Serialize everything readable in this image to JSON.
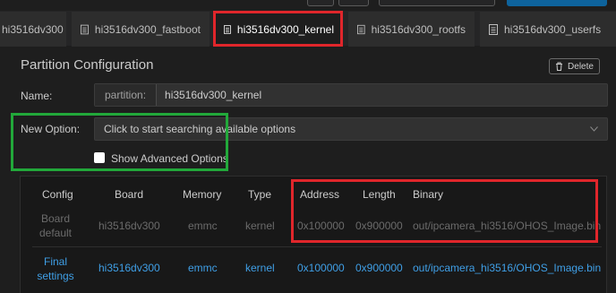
{
  "tabs": [
    {
      "label": "hi3516dv300",
      "active": false
    },
    {
      "label": "hi3516dv300_fastboot",
      "active": false
    },
    {
      "label": "hi3516dv300_kernel",
      "active": true
    },
    {
      "label": "hi3516dv300_rootfs",
      "active": false
    },
    {
      "label": "hi3516dv300_userfs",
      "active": false
    }
  ],
  "panel": {
    "title": "Partition Configuration",
    "delete_label": "Delete"
  },
  "form": {
    "name_label": "Name",
    "name_prefix": "partition:",
    "name_value": "hi3516dv300_kernel",
    "option_label": "New Option",
    "option_placeholder": "Click to start searching available options",
    "advanced_label": "Show Advanced Options",
    "advanced_checked": false
  },
  "table": {
    "headers": [
      "Config",
      "Board",
      "Memory",
      "Type",
      "Address",
      "Length",
      "Binary"
    ],
    "rows": [
      {
        "config": "Board default",
        "config_l1": "Board",
        "config_l2": "default",
        "board": "hi3516dv300",
        "memory": "emmc",
        "type": "kernel",
        "address": "0x100000",
        "length": "0x900000",
        "binary": "out/ipcamera_hi3516/OHOS_Image.bin"
      },
      {
        "config": "Final settings",
        "config_l1": "Final",
        "config_l2": "settings",
        "board": "hi3516dv300",
        "memory": "emmc",
        "type": "kernel",
        "address": "0x100000",
        "length": "0x900000",
        "binary": "out/ipcamera_hi3516/OHOS_Image.bin"
      }
    ]
  },
  "colors": {
    "accent_blue": "#3f9fe6",
    "highlight_red": "#e0262b",
    "highlight_green": "#22a83a"
  }
}
